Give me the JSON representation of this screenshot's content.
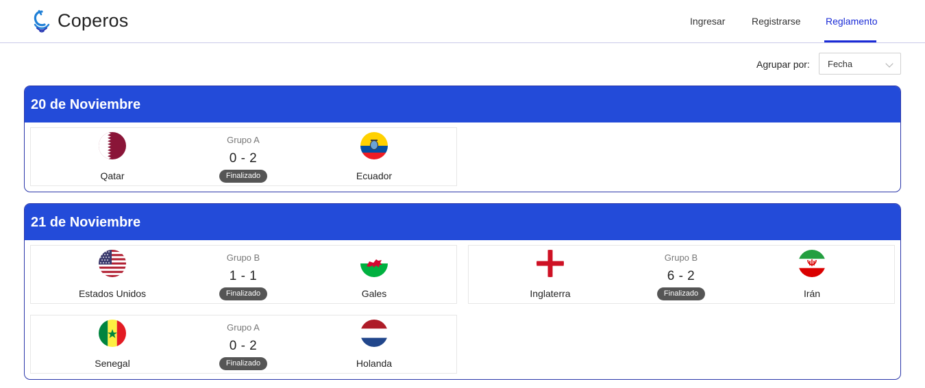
{
  "header": {
    "brand": "Coperos",
    "nav": [
      "Ingresar",
      "Registrarse",
      "Reglamento"
    ],
    "active_nav": "Reglamento"
  },
  "filters": {
    "group_by_label": "Agrupar por:",
    "group_by_value": "Fecha"
  },
  "colors": {
    "accent": "#1a2bd6",
    "day_header": "#234bd9",
    "badge": "#555555"
  },
  "days": [
    {
      "title": "20 de Noviembre",
      "matches": [
        {
          "group": "Grupo A",
          "score": "0 - 2",
          "status": "Finalizado",
          "home": "Qatar",
          "away": "Ecuador",
          "home_flag": "qatar-flag",
          "away_flag": "ecuador-flag"
        }
      ]
    },
    {
      "title": "21 de Noviembre",
      "matches": [
        {
          "group": "Grupo B",
          "score": "1 - 1",
          "status": "Finalizado",
          "home": "Estados Unidos",
          "away": "Gales",
          "home_flag": "usa-flag",
          "away_flag": "wales-flag"
        },
        {
          "group": "Grupo B",
          "score": "6 - 2",
          "status": "Finalizado",
          "home": "Inglaterra",
          "away": "Irán",
          "home_flag": "england-flag",
          "away_flag": "iran-flag"
        },
        {
          "group": "Grupo A",
          "score": "0 - 2",
          "status": "Finalizado",
          "home": "Senegal",
          "away": "Holanda",
          "home_flag": "senegal-flag",
          "away_flag": "netherlands-flag"
        }
      ]
    }
  ]
}
